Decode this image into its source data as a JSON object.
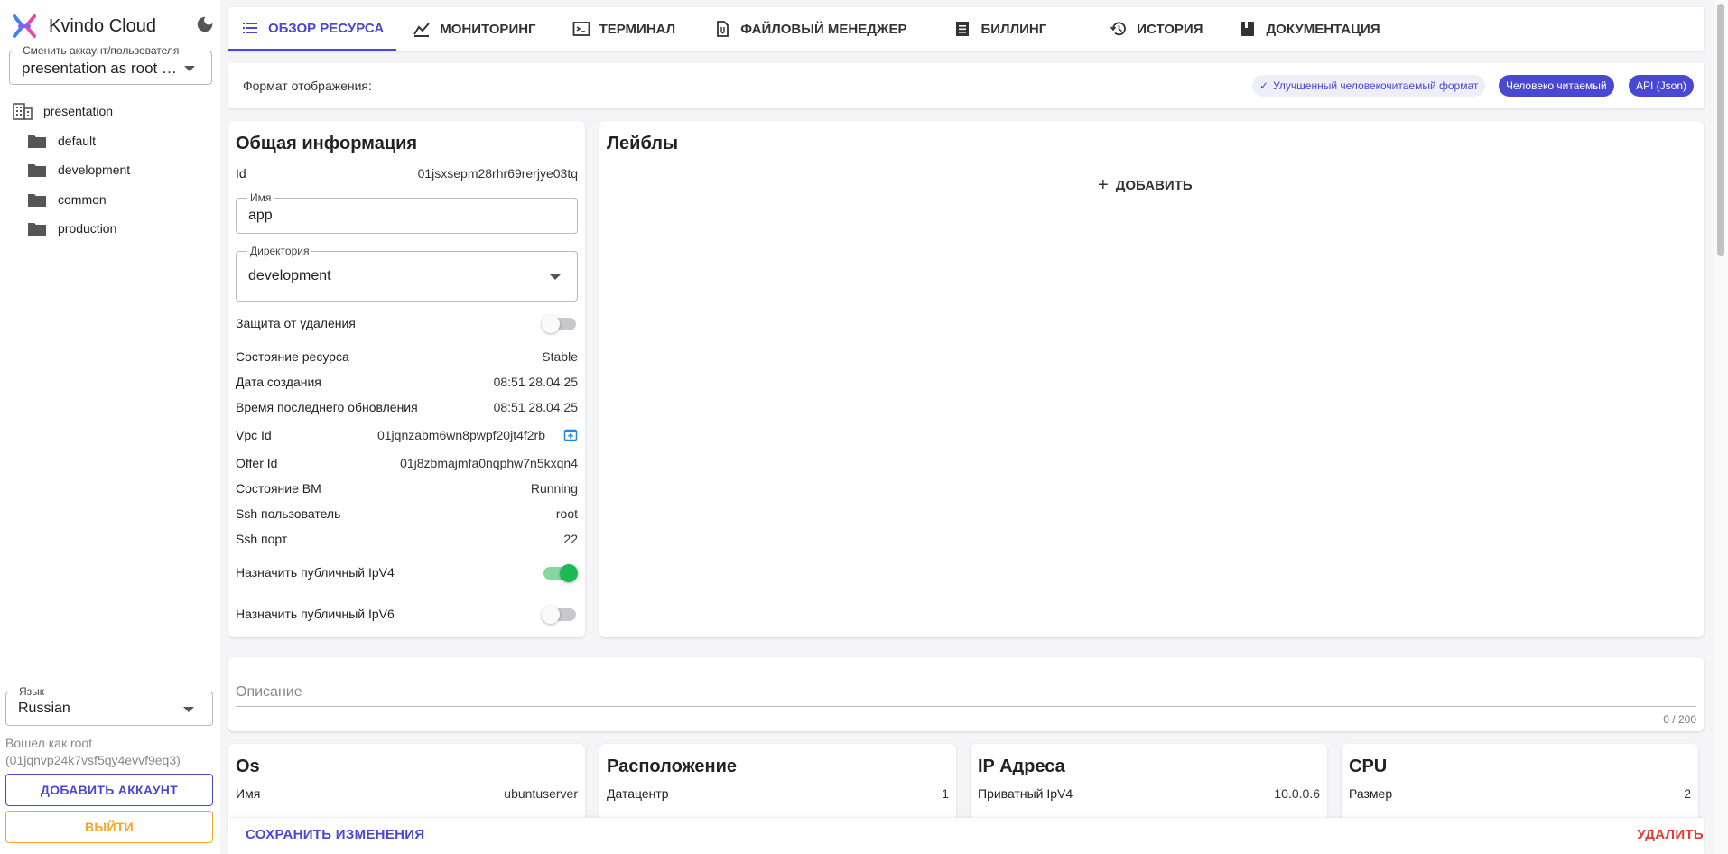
{
  "sidebar": {
    "brand": "Kvindo Cloud",
    "account_select": {
      "legend": "Сменить аккаунт/пользователя",
      "value": "presentation as root (…"
    },
    "tree": {
      "root": "presentation",
      "folders": [
        "default",
        "development",
        "common",
        "production"
      ]
    },
    "language": {
      "legend": "Язык",
      "value": "Russian"
    },
    "logged_in_as": "Вошел как root (01jqnvp24k7vsf5qy4evvf9eq3)",
    "add_account": "ДОБАВИТЬ АККАУНТ",
    "logout": "ВЫЙТИ"
  },
  "tabs": [
    {
      "label": "ОБЗОР РЕСУРСА",
      "icon": "list-icon",
      "active": true
    },
    {
      "label": "МОНИТОРИНГ",
      "icon": "chart-icon"
    },
    {
      "label": "ТЕРМИНАЛ",
      "icon": "terminal-icon"
    },
    {
      "label": "ФАЙЛОВЫЙ МЕНЕДЖЕР",
      "icon": "file-icon"
    },
    {
      "label": "БИЛЛИНГ",
      "icon": "receipt-icon"
    },
    {
      "label": "ИСТОРИЯ",
      "icon": "history-icon"
    },
    {
      "label": "ДОКУМЕНТАЦИЯ",
      "icon": "book-icon"
    }
  ],
  "format": {
    "label": "Формат отображения:",
    "chips": [
      "Улучшенный человекочитаемый формат",
      "Человеко читаемый",
      "API (Json)"
    ]
  },
  "general": {
    "title": "Общая информация",
    "id_label": "Id",
    "id_value": "01jsxsepm28rhr69rerjye03tq",
    "name_legend": "Имя",
    "name_value": "app",
    "dir_legend": "Директория",
    "dir_value": "development",
    "delete_protection": "Защита от удаления",
    "rows": [
      {
        "label": "Состояние ресурса",
        "value": "Stable"
      },
      {
        "label": "Дата создания",
        "value": "08:51 28.04.25"
      },
      {
        "label": "Время последнего обновления",
        "value": "08:51 28.04.25"
      }
    ],
    "vpc_label": "Vpc Id",
    "vpc_value": "01jqnzabm6wn8pwpf20jt4f2rb",
    "rows2": [
      {
        "label": "Offer Id",
        "value": "01j8zbmajmfa0nqphw7n5kxqn4"
      },
      {
        "label": "Состояние ВМ",
        "value": "Running"
      },
      {
        "label": "Ssh пользователь",
        "value": "root"
      },
      {
        "label": "Ssh порт",
        "value": "22"
      }
    ],
    "public_ipv4": "Назначить публичный IpV4",
    "public_ipv6": "Назначить публичный IpV6"
  },
  "labels": {
    "title": "Лейблы",
    "add": "ДОБАВИТЬ"
  },
  "description": {
    "placeholder": "Описание",
    "counter": "0 / 200"
  },
  "os": {
    "title": "Os",
    "label": "Имя",
    "value": "ubuntuserver"
  },
  "location": {
    "title": "Расположение",
    "label": "Датацентр",
    "value": "1"
  },
  "ip": {
    "title": "IP Адреса",
    "label": "Приватный IpV4",
    "value": "10.0.0.6"
  },
  "cpu": {
    "title": "CPU",
    "label": "Размер",
    "value": "2"
  },
  "actions": {
    "save": "СОХРАНИТЬ ИЗМЕНЕНИЯ",
    "delete": "УДАЛИТЬ"
  },
  "colors": {
    "accent": "#4a47d1",
    "danger": "#e53935",
    "warning": "#f5a623",
    "switch_on": "#1db954"
  }
}
